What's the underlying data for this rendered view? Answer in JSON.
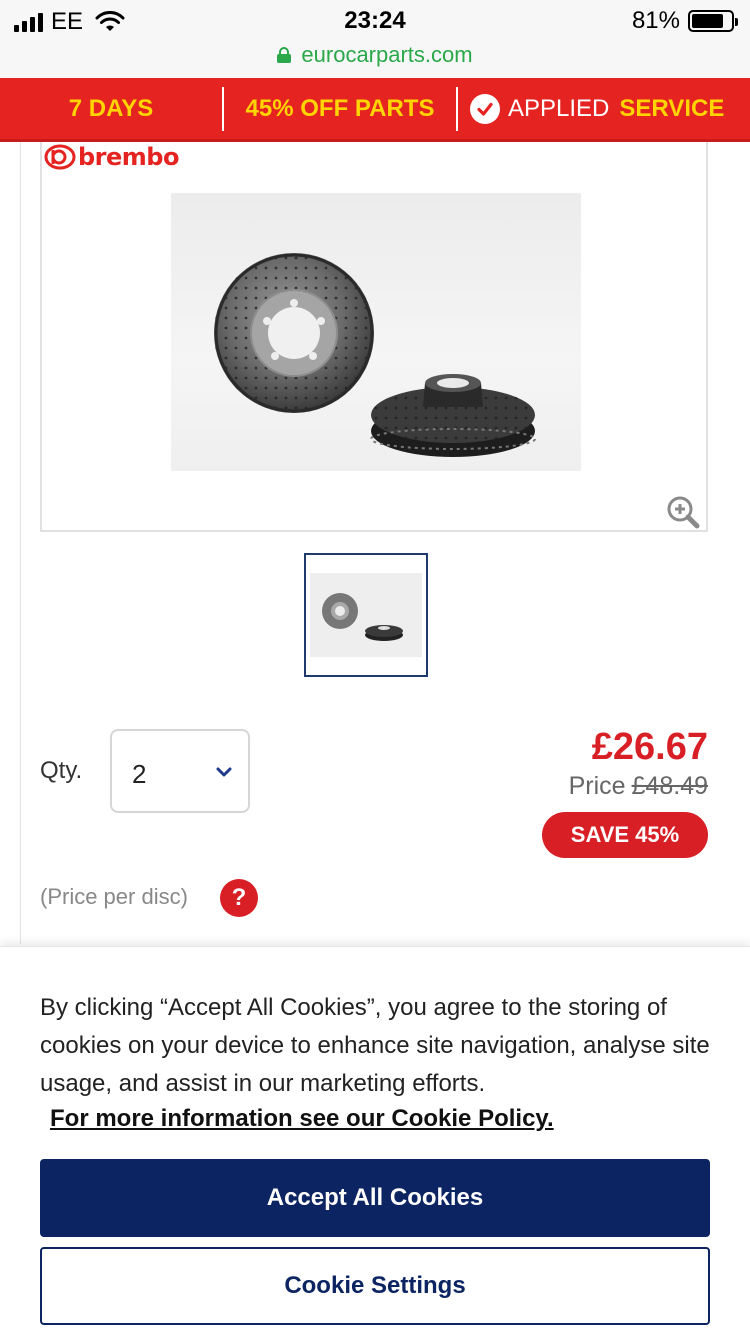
{
  "status_bar": {
    "carrier": "EE",
    "time": "23:24",
    "battery": "81%",
    "battery_level": 0.81
  },
  "browser": {
    "url": "eurocarparts.com"
  },
  "promo": {
    "days": "7 DAYS",
    "discount": "45% OFF PARTS",
    "applied": "APPLIED",
    "service": "SERVICE"
  },
  "product": {
    "brand": "brembo",
    "image_icon": "brake-disc-photo",
    "zoom_icon": "zoom-in-icon",
    "qty_label": "Qty.",
    "qty_value": "2",
    "price_now": "£26.67",
    "price_label": "Price",
    "price_was": "£48.49",
    "save_badge": "SAVE 45%",
    "per_disc": "(Price per disc)",
    "help_symbol": "?"
  },
  "cookie_banner": {
    "text": "By clicking “Accept All Cookies”, you agree to the storing of cookies on your device to enhance site navigation, analyse site usage, and assist in our marketing efforts.",
    "link": "For more information see our Cookie Policy.",
    "accept_button": "Accept All Cookies",
    "settings_button": "Cookie Settings"
  },
  "colors": {
    "promo_red": "#e52421",
    "promo_yellow": "#ffd400",
    "price_red": "#d91f26",
    "navy": "#0c2461",
    "url_green": "#2aa84a"
  }
}
